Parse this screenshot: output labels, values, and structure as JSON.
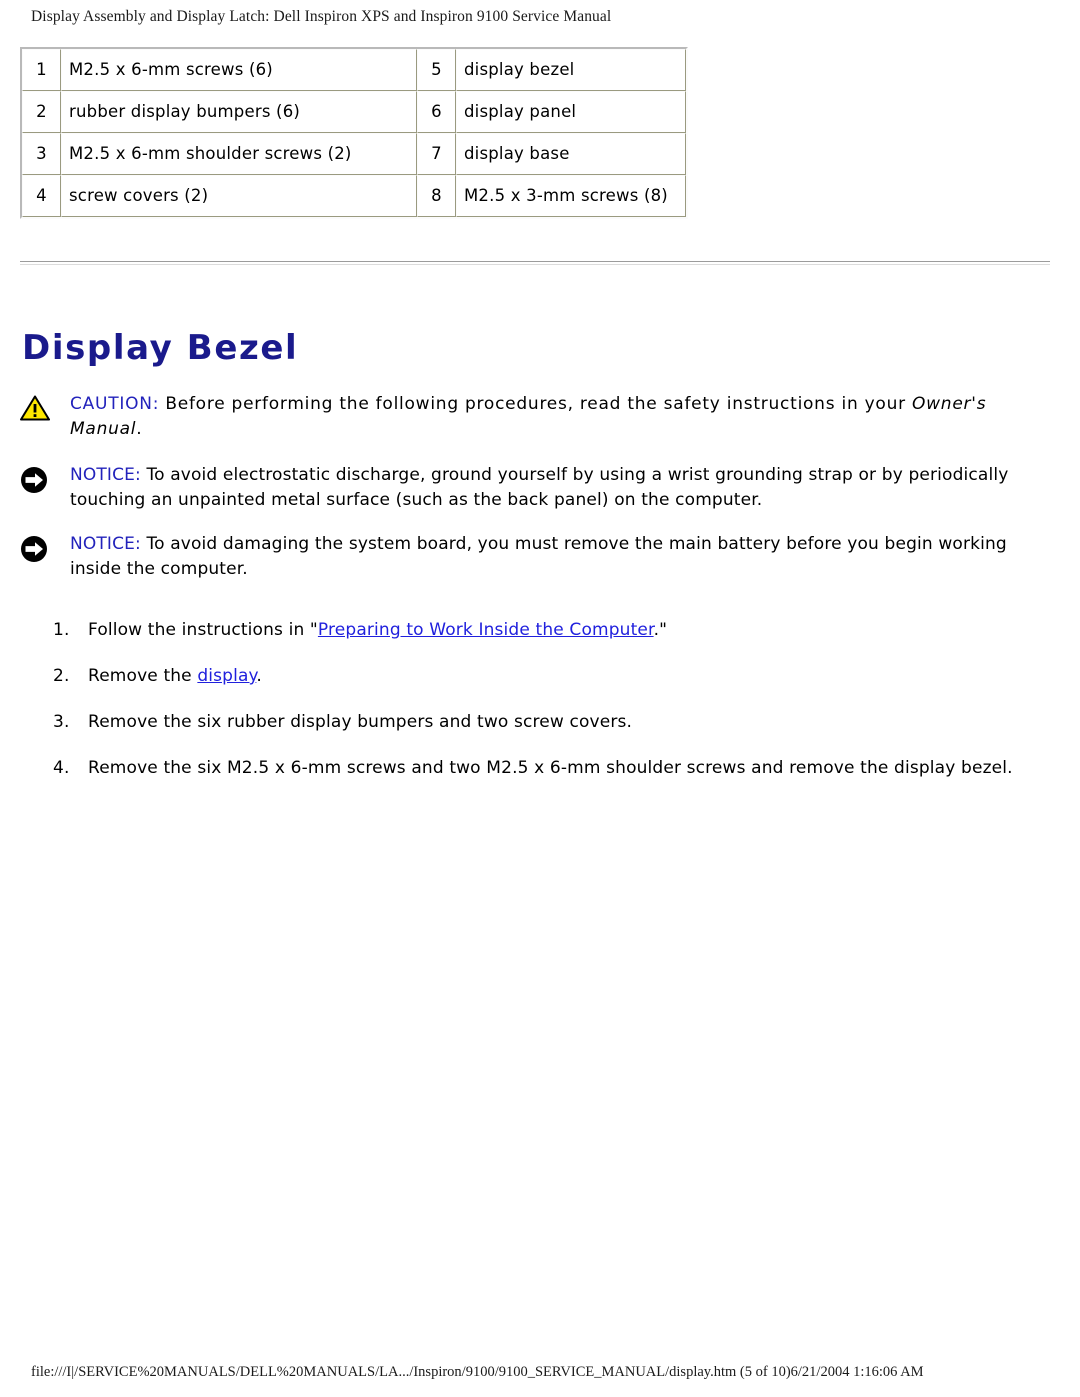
{
  "page": {
    "header_title": "Display Assembly and Display Latch: Dell Inspiron XPS and Inspiron 9100 Service Manual",
    "footer_text": "file:///I|/SERVICE%20MANUALS/DELL%20MANUALS/LA.../Inspiron/9100/9100_SERVICE_MANUAL/display.htm (5 of 10)6/21/2004 1:16:06 AM",
    "background_color": "#ffffff",
    "text_color": "#000000"
  },
  "legend_table": {
    "rows": [
      {
        "left_num": "1",
        "left_label": "M2.5 x 6-mm screws (6)",
        "right_num": "5",
        "right_label": "display bezel"
      },
      {
        "left_num": "2",
        "left_label": "rubber display bumpers (6)",
        "right_num": "6",
        "right_label": "display panel"
      },
      {
        "left_num": "3",
        "left_label": "M2.5 x 6-mm shoulder screws (2)",
        "right_num": "7",
        "right_label": "display base"
      },
      {
        "left_num": "4",
        "left_label": "screw covers (2)",
        "right_num": "8",
        "right_label": "M2.5 x 3-mm screws (8)"
      }
    ],
    "border_color": "#9a9a80"
  },
  "section": {
    "title": "Display Bezel",
    "title_color": "#1a1a8c"
  },
  "admonitions": [
    {
      "kind": "caution",
      "icon": "warning-triangle-icon",
      "keyword": "CAUTION:",
      "keyword_color": "#2222bb",
      "text_before_italic": " Before performing the following procedures, read the safety instructions in your ",
      "italic_text": "Owner's Manual",
      "text_after_italic": "."
    },
    {
      "kind": "notice",
      "icon": "notice-arrow-icon",
      "keyword": "NOTICE:",
      "keyword_color": "#2222bb",
      "text": " To avoid electrostatic discharge, ground yourself by using a wrist grounding strap or by periodically touching an unpainted metal surface (such as the back panel) on the computer."
    },
    {
      "kind": "notice",
      "icon": "notice-arrow-icon",
      "keyword": "NOTICE:",
      "keyword_color": "#2222bb",
      "text": " To avoid damaging the system board, you must remove the main battery before you begin working inside the computer."
    }
  ],
  "steps": [
    {
      "marker": "1.",
      "prefix": "Follow the instructions in \"",
      "link_text": "Preparing to Work Inside the Computer",
      "suffix": ".\""
    },
    {
      "marker": "2.",
      "prefix": "Remove the ",
      "link_text": "display",
      "suffix": "."
    },
    {
      "marker": "3.",
      "prefix": "Remove the six rubber display bumpers and two screw covers.",
      "link_text": "",
      "suffix": ""
    },
    {
      "marker": "4.",
      "prefix": "Remove the six M2.5 x 6-mm screws and two M2.5 x 6-mm shoulder screws and remove the display bezel.",
      "link_text": "",
      "suffix": ""
    }
  ],
  "link_color": "#2020dd"
}
